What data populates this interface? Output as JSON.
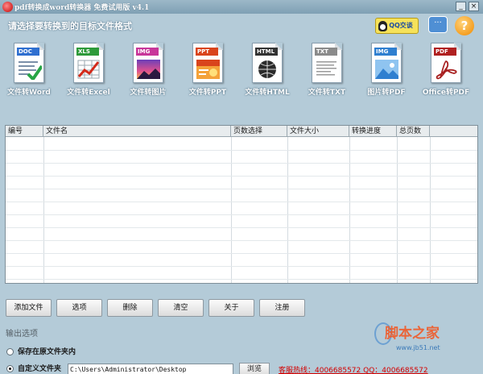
{
  "window": {
    "title": "pdf转换成word转换器 免费试用版 v4.1",
    "minimize_glyph": "_",
    "close_glyph": "×"
  },
  "header": {
    "prompt": "请选择要转换到的目标文件格式",
    "qq_label": "QQ交谈",
    "chat_glyph": "···",
    "help_glyph": "?"
  },
  "converters": [
    {
      "tag": "DOC",
      "label": "文件转Word",
      "tag_color": "#2f6fd0",
      "icon": "word-document-icon"
    },
    {
      "tag": "XLS",
      "label": "文件转Excel",
      "tag_color": "#2e9a3a",
      "icon": "excel-chart-icon"
    },
    {
      "tag": "IMG",
      "label": "文件转图片",
      "tag_color": "#c8369a",
      "icon": "image-document-icon"
    },
    {
      "tag": "PPT",
      "label": "文件转PPT",
      "tag_color": "#d9441c",
      "icon": "ppt-document-icon"
    },
    {
      "tag": "HTML",
      "label": "文件转HTML",
      "tag_color": "#333333",
      "icon": "html-globe-icon"
    },
    {
      "tag": "TXT",
      "label": "文件转TXT",
      "tag_color": "#8a8a8a",
      "icon": "text-document-icon"
    },
    {
      "tag": "IMG",
      "label": "图片转PDF",
      "tag_color": "#2f7fd0",
      "icon": "image-to-pdf-icon"
    },
    {
      "tag": "PDF",
      "label": "Office转PDF",
      "tag_color": "#b02020",
      "icon": "acrobat-pdf-icon"
    }
  ],
  "table": {
    "columns": [
      "编号",
      "文件名",
      "页数选择",
      "文件大小",
      "转换进度",
      "总页数"
    ],
    "rows": []
  },
  "actions": [
    "添加文件",
    "选项",
    "删除",
    "清空",
    "关于",
    "注册"
  ],
  "output": {
    "title": "输出选项",
    "option_same_folder": "保存在原文件夹内",
    "option_custom_folder": "自定义文件夹",
    "path": "C:\\Users\\Administrator\\Desktop",
    "browse_label": "浏览",
    "hotline": "客服热线：4006685572 QQ：4006685572",
    "selected_option": "custom"
  },
  "watermark": {
    "brand": "脚本之家",
    "url": "www.jb51.net"
  },
  "colors": {
    "window_bg": "#b4cbd8",
    "title_bar": "#7fa0b4",
    "hotline": "#d40000"
  }
}
